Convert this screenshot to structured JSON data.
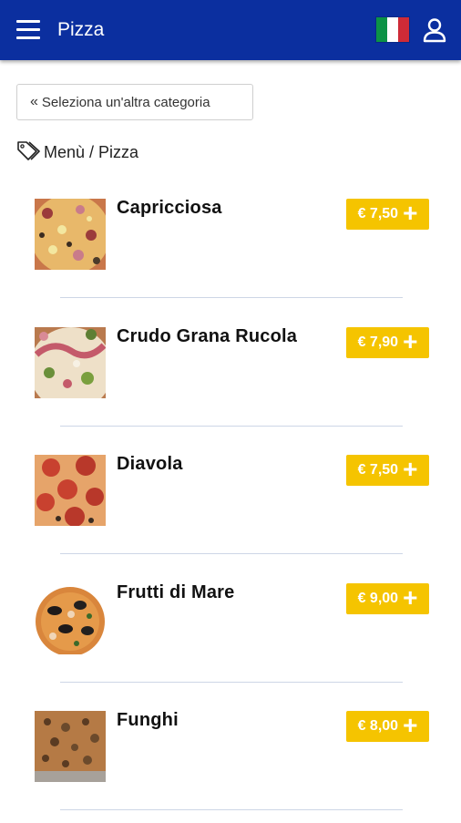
{
  "header": {
    "title": "Pizza",
    "menu_icon": "hamburger-menu-icon",
    "flag_icon": "italian-flag-icon",
    "user_icon": "user-icon",
    "bar_color": "#0b2f9f"
  },
  "navigation": {
    "back_label": "Seleziona un'altra categoria",
    "back_icon": "double-chevron-left-icon",
    "breadcrumb": "Menù / Pizza",
    "breadcrumb_icon": "tag-icon"
  },
  "menu_items": [
    {
      "name": "Capricciosa",
      "price": "€ 7,50",
      "image": "pizza-capricciosa-image"
    },
    {
      "name": "Crudo Grana Rucola",
      "price": "€ 7,90",
      "image": "pizza-crudo-grana-rucola-image"
    },
    {
      "name": "Diavola",
      "price": "€ 7,50",
      "image": "pizza-diavola-image"
    },
    {
      "name": "Frutti di Mare",
      "price": "€ 9,00",
      "image": "pizza-frutti-di-mare-image"
    },
    {
      "name": "Funghi",
      "price": "€ 8,00",
      "image": "pizza-funghi-image"
    }
  ],
  "add_icon": "plus-icon",
  "accent_color": "#f5c400"
}
